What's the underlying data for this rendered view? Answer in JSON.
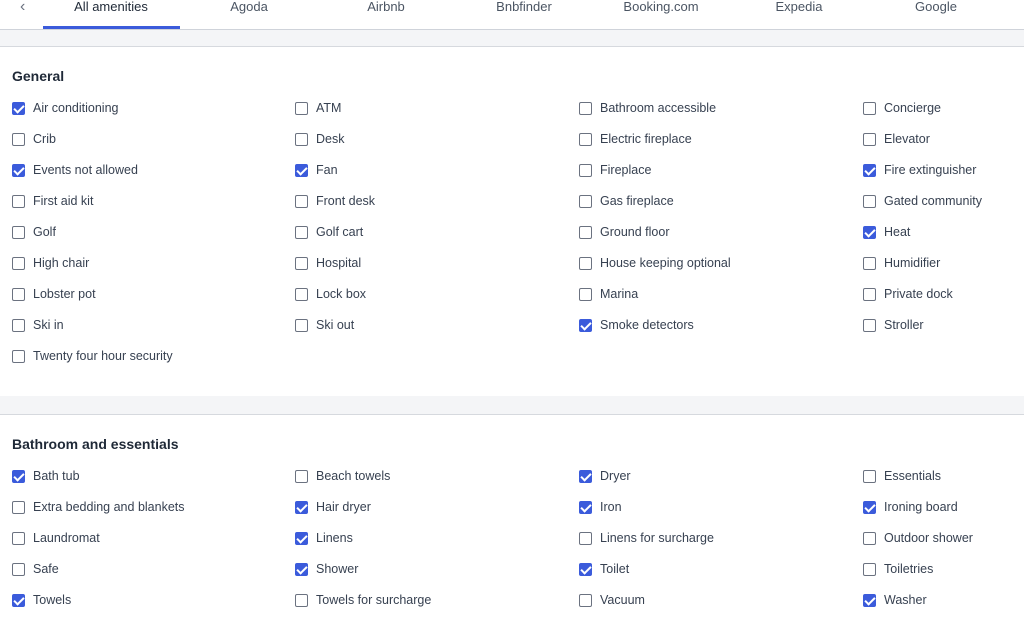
{
  "tabs": {
    "items": [
      "All amenities",
      "Agoda",
      "Airbnb",
      "Bnbfinder",
      "Booking.com",
      "Expedia",
      "Google"
    ],
    "active": "All amenities"
  },
  "sections": [
    {
      "title": "General",
      "items": [
        {
          "label": "Air conditioning",
          "checked": true
        },
        {
          "label": "ATM",
          "checked": false
        },
        {
          "label": "Bathroom accessible",
          "checked": false
        },
        {
          "label": "Concierge",
          "checked": false
        },
        {
          "label": "Crib",
          "checked": false
        },
        {
          "label": "Desk",
          "checked": false
        },
        {
          "label": "Electric fireplace",
          "checked": false
        },
        {
          "label": "Elevator",
          "checked": false
        },
        {
          "label": "Events not allowed",
          "checked": true
        },
        {
          "label": "Fan",
          "checked": true
        },
        {
          "label": "Fireplace",
          "checked": false
        },
        {
          "label": "Fire extinguisher",
          "checked": true
        },
        {
          "label": "First aid kit",
          "checked": false
        },
        {
          "label": "Front desk",
          "checked": false
        },
        {
          "label": "Gas fireplace",
          "checked": false
        },
        {
          "label": "Gated community",
          "checked": false
        },
        {
          "label": "Golf",
          "checked": false
        },
        {
          "label": "Golf cart",
          "checked": false
        },
        {
          "label": "Ground floor",
          "checked": false
        },
        {
          "label": "Heat",
          "checked": true
        },
        {
          "label": "High chair",
          "checked": false
        },
        {
          "label": "Hospital",
          "checked": false
        },
        {
          "label": "House keeping optional",
          "checked": false
        },
        {
          "label": "Humidifier",
          "checked": false
        },
        {
          "label": "Lobster pot",
          "checked": false
        },
        {
          "label": "Lock box",
          "checked": false
        },
        {
          "label": "Marina",
          "checked": false
        },
        {
          "label": "Private dock",
          "checked": false
        },
        {
          "label": "Ski in",
          "checked": false
        },
        {
          "label": "Ski out",
          "checked": false
        },
        {
          "label": "Smoke detectors",
          "checked": true
        },
        {
          "label": "Stroller",
          "checked": false
        },
        {
          "label": "Twenty four hour security",
          "checked": false
        }
      ]
    },
    {
      "title": "Bathroom and essentials",
      "items": [
        {
          "label": "Bath tub",
          "checked": true
        },
        {
          "label": "Beach towels",
          "checked": false
        },
        {
          "label": "Dryer",
          "checked": true
        },
        {
          "label": "Essentials",
          "checked": false
        },
        {
          "label": "Extra bedding and blankets",
          "checked": false
        },
        {
          "label": "Hair dryer",
          "checked": true
        },
        {
          "label": "Iron",
          "checked": true
        },
        {
          "label": "Ironing board",
          "checked": true
        },
        {
          "label": "Laundromat",
          "checked": false
        },
        {
          "label": "Linens",
          "checked": true
        },
        {
          "label": "Linens for surcharge",
          "checked": false
        },
        {
          "label": "Outdoor shower",
          "checked": false
        },
        {
          "label": "Safe",
          "checked": false
        },
        {
          "label": "Shower",
          "checked": true
        },
        {
          "label": "Toilet",
          "checked": true
        },
        {
          "label": "Toiletries",
          "checked": false
        },
        {
          "label": "Towels",
          "checked": true
        },
        {
          "label": "Towels for surcharge",
          "checked": false
        },
        {
          "label": "Vacuum",
          "checked": false
        },
        {
          "label": "Washer",
          "checked": true
        }
      ]
    }
  ],
  "colors": {
    "accent": "#3b5bdb",
    "background": "#f4f5f7"
  },
  "icons": {
    "back": "chevron-left-icon",
    "checkbox": "check-icon"
  }
}
